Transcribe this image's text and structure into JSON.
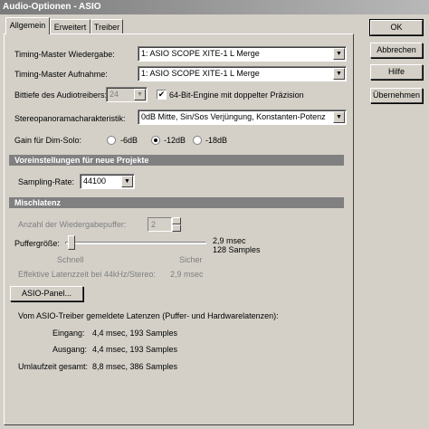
{
  "window": {
    "title": "Audio-Optionen - ASIO"
  },
  "tabs": [
    {
      "label": "Allgemein",
      "active": true
    },
    {
      "label": "Erweitert",
      "active": false
    },
    {
      "label": "Treiber",
      "active": false
    }
  ],
  "buttons": {
    "ok": "OK",
    "cancel": "Abbrechen",
    "help": "Hilfe",
    "apply": "Übernehmen",
    "asio_panel": "ASIO-Panel..."
  },
  "general": {
    "timing_playback_label": "Timing-Master Wiedergabe:",
    "timing_playback_value": "1: ASIO SCOPE XITE-1 L Merge",
    "timing_record_label": "Timing-Master Aufnahme:",
    "timing_record_value": "1: ASIO SCOPE XITE-1 L Merge",
    "bitdepth_label": "Bittiefe des Audiotreibers:",
    "bitdepth_value": "24",
    "engine64_label": "64-Bit-Engine mit doppelter Präzision",
    "engine64_checked": true,
    "panning_label": "Stereopanoramacharakteristik:",
    "panning_value": "0dB Mitte, Sin/Sos Verjüngung, Konstanten-Potenz",
    "gain_label": "Gain für Dim-Solo:",
    "gain_options": [
      "-6dB",
      "-12dB",
      "-18dB"
    ],
    "gain_selected": "-12dB"
  },
  "project_defaults": {
    "header": "Voreinstellungen für neue Projekte",
    "sampling_label": "Sampling-Rate:",
    "sampling_value": "44100"
  },
  "latency": {
    "header": "Mischlatenz",
    "buffers_label": "Anzahl der Wiedergabepuffer:",
    "buffers_value": "2",
    "buffer_size_label": "Puffergröße:",
    "slider_left": "Schnell",
    "slider_right": "Sicher",
    "slider_position": 0.02,
    "buffer_msec": "2,9 msec",
    "buffer_samples": "128 Samples",
    "effective_label": "Effektive Latenzzeit bei 44kHz/Stereo:",
    "effective_value": "2,9 msec"
  },
  "reported": {
    "intro": "Vom ASIO-Treiber gemeldete Latenzen (Puffer- und Hardwarelatenzen):",
    "input_label": "Eingang:",
    "input_value": "4,4 msec, 193 Samples",
    "output_label": "Ausgang:",
    "output_value": "4,4 msec, 193 Samples",
    "roundtrip_label": "Umlaufzeit gesamt:",
    "roundtrip_value": "8,8 msec, 386 Samples"
  }
}
